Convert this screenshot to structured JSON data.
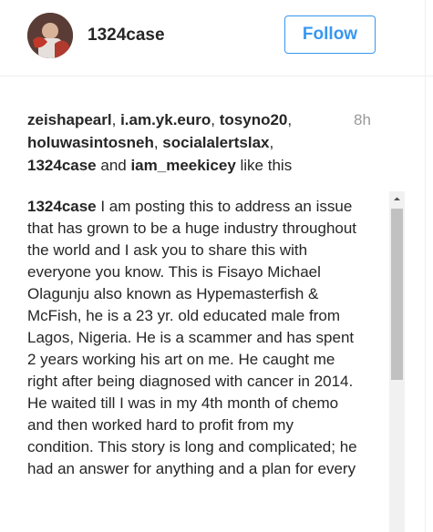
{
  "header": {
    "username": "1324case",
    "follow_label": "Follow"
  },
  "likes": {
    "users": [
      "zeishapearl",
      "i.am.yk.euro",
      "tosyno20",
      "holuwasintosneh",
      "socialalertslax",
      "1324case",
      "iam_meekicey"
    ],
    "sep": ", ",
    "and": " and ",
    "suffix": " like this",
    "time": "8h"
  },
  "caption": {
    "author": "1324case",
    "text": " I am posting this to address an issue that has grown to be a huge industry throughout the world and I ask you to share this with everyone you know. This is Fisayo Michael Olagunju also known as Hypemasterfish & McFish, he is a 23 yr. old educated male from Lagos, Nigeria. He is a scammer and has spent 2 years working his art on me. He caught me right after being diagnosed with cancer in 2014. He waited till I was in my 4th month of chemo and then worked hard to profit from my condition. This story is long and complicated; he had an answer for anything and a plan for every"
  },
  "icons": {
    "scroll_up": "chevron-up-icon"
  },
  "colors": {
    "accent": "#3897f0",
    "text": "#262626",
    "muted": "#999999"
  }
}
